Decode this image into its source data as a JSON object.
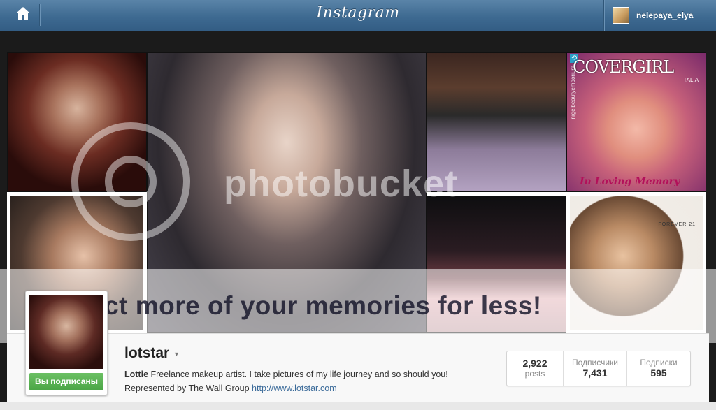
{
  "topbar": {
    "home_icon": "home-icon",
    "logo": "Instagram",
    "username": "nelepaya_elya"
  },
  "grid": {
    "covergirl": {
      "logo": "COVERGIRL",
      "sub": "TALIA",
      "memory": "In Loving Memory",
      "handle": "nigelbeautyemporium"
    },
    "forever": "FOREVER 21"
  },
  "watermark": {
    "brand": "photobucket",
    "banner": "Protect more of your memories for less!"
  },
  "profile": {
    "username": "lotstar",
    "follow_status": "Вы подписаны",
    "bio_name": "Lottie",
    "bio_text": " Freelance makeup artist. I take pictures of my life journey and so should you!",
    "bio_line2": "Represented by The Wall Group ",
    "bio_link": "http://www.lotstar.com",
    "stats": {
      "posts_value": "2,922",
      "posts_label": "posts",
      "followers_label": "Подписчики",
      "followers_value": "7,431",
      "following_label": "Подписки",
      "following_value": "595"
    }
  }
}
